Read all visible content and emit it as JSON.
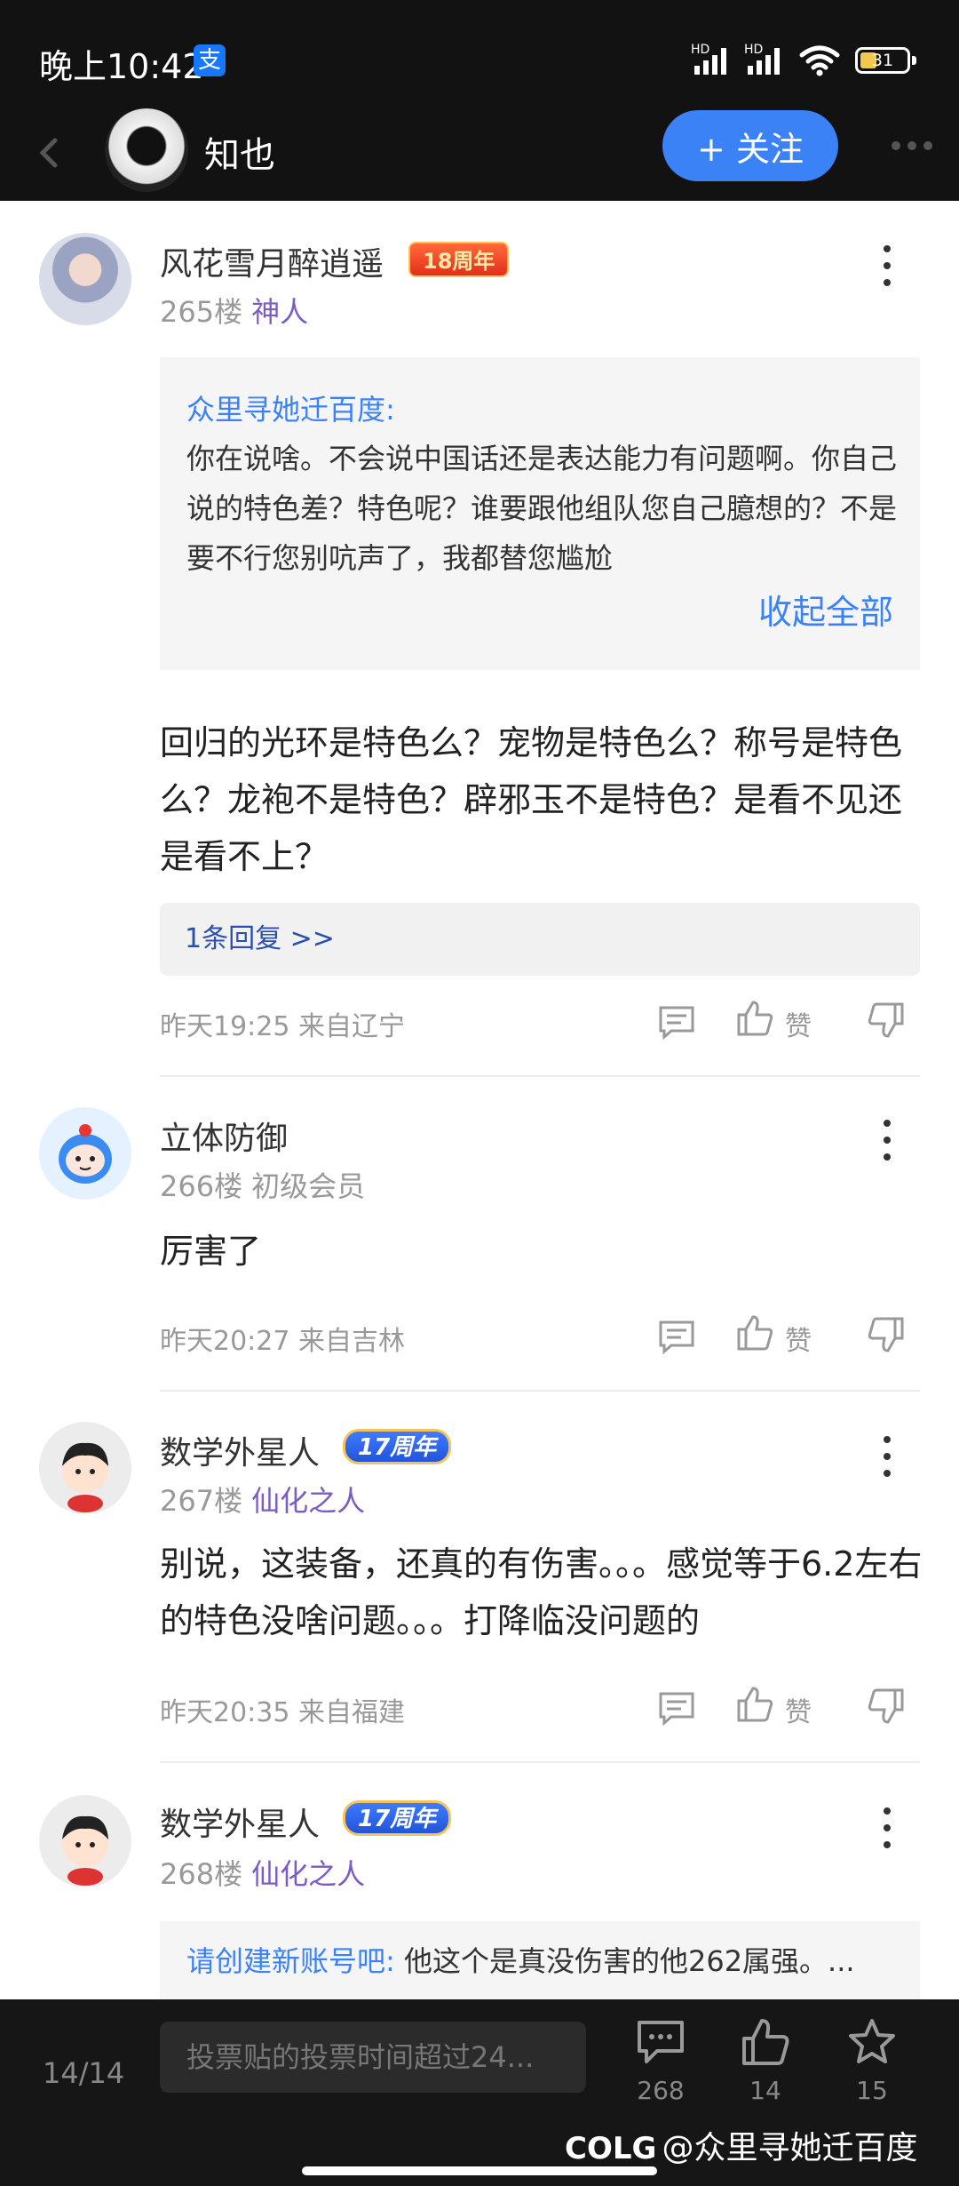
{
  "status_bar": {
    "time": "晚上10:42",
    "pay_icon": "支",
    "battery": "31"
  },
  "header": {
    "name": "知也",
    "follow_label": "+ 关注"
  },
  "posts": [
    {
      "username": "风花雪月醉逍遥",
      "badge": "18周年",
      "floor": "265楼",
      "title": "神人",
      "quote": {
        "author": "众里寻她迁百度:",
        "text": "你在说啥。不会说中国话还是表达能力有问题啊。你自己说的特色差？特色呢？谁要跟他组队您自己臆想的？不是要不行您别吭声了，我都替您尴尬",
        "collapse": "收起全部"
      },
      "content": "回归的光环是特色么？宠物是特色么？称号是特色么？龙袍不是特色？辟邪玉不是特色？是看不见还是看不上？",
      "replies": "1条回复 >>",
      "meta": "昨天19:25 来自辽宁",
      "like_label": "赞"
    },
    {
      "username": "立体防御",
      "floor": "266楼",
      "title": "初级会员",
      "content": "厉害了",
      "meta": "昨天20:27 来自吉林",
      "like_label": "赞"
    },
    {
      "username": "数学外星人",
      "badge": "17周年",
      "floor": "267楼",
      "title": "仙化之人",
      "content": "别说，这装备，还真的有伤害。。。感觉等于6.2左右的特色没啥问题。。。打降临没问题的",
      "meta": "昨天20:35 来自福建",
      "like_label": "赞"
    },
    {
      "username": "数学外星人",
      "badge": "17周年",
      "floor": "268楼",
      "title": "仙化之人",
      "quote": {
        "author": "请创建新账号吧:",
        "text": " 他这个是真没伤害的他262属强。..."
      }
    }
  ],
  "bottom_bar": {
    "page": "14/14",
    "input_placeholder": "投票贴的投票时间超过24...",
    "comment_count": "268",
    "like_count": "14",
    "star_count": "15",
    "watermark_logo": "COLG",
    "watermark_text": "@众里寻她迁百度"
  }
}
